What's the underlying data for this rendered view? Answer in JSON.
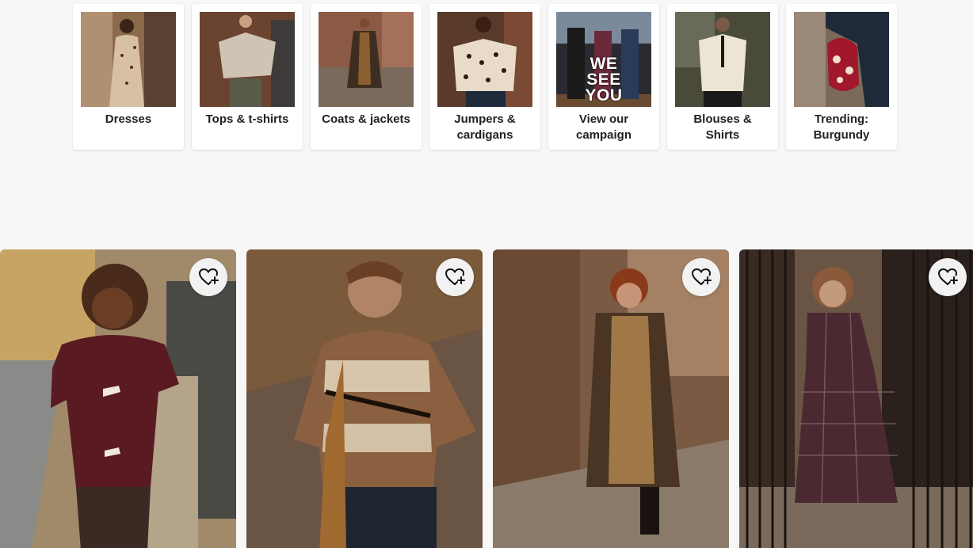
{
  "categories": [
    {
      "label": "Dresses"
    },
    {
      "label": "Tops & t-shirts"
    },
    {
      "label": "Coats & jackets"
    },
    {
      "label": "Jumpers & cardigans"
    },
    {
      "label": "View our campaign",
      "image_text": [
        "WE",
        "SEE",
        "YOU"
      ]
    },
    {
      "label": "Blouses & Shirts"
    },
    {
      "label": "Trending: Burgundy"
    }
  ],
  "icons": {
    "favourite": "heart-plus-icon"
  },
  "colors": {
    "page_background": "#f7f7f7",
    "card_background": "#ffffff",
    "text": "#222222",
    "favourite_button": "#f2f2f2"
  }
}
